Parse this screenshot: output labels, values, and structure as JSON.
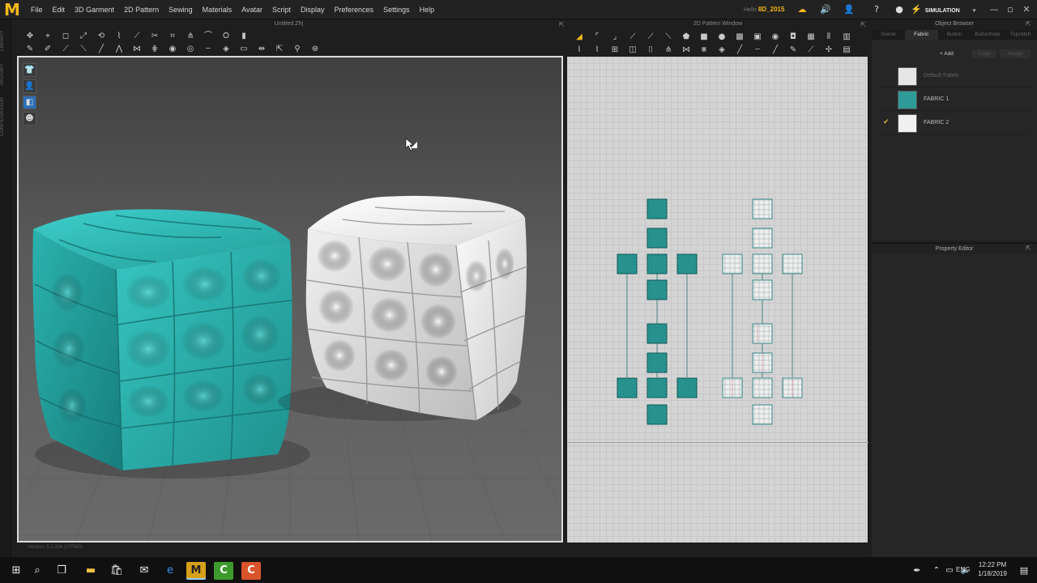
{
  "app": {
    "logo": "M",
    "window_title": "Untitled.Zfrj"
  },
  "menu": [
    "File",
    "Edit",
    "3D Garment",
    "2D Pattern",
    "Sewing",
    "Materials",
    "Avatar",
    "Script",
    "Display",
    "Preferences",
    "Settings",
    "Help"
  ],
  "user": {
    "hint": "Hello",
    "name": "IID_2015"
  },
  "simulation": {
    "label": "SIMULATION"
  },
  "left_tabs": [
    "LIBRARY",
    "HISTORY",
    "CONFIGURATOR"
  ],
  "pattern_window": {
    "title": "2D Pattern Window"
  },
  "object_browser": {
    "title": "Object Browser",
    "tabs": [
      "Scene",
      "Fabric",
      "Button",
      "Buttonhole",
      "Topstitch"
    ],
    "active_tab": "Fabric",
    "add_label": "+ Add",
    "copy_label": "Copy",
    "assign_label": "Assign",
    "fabrics": [
      {
        "name": "Default Fabric",
        "color": "#e6e6e6",
        "checked": false
      },
      {
        "name": "FABRIC 1",
        "color": "#2e9b98",
        "checked": false
      },
      {
        "name": "FABRIC 2",
        "color": "#f0f0f0",
        "checked": true
      }
    ]
  },
  "property_editor": {
    "title": "Property Editor"
  },
  "viewport_status": "Version: 5.2.334   (r27580)",
  "taskbar": {
    "lang": "ENG",
    "time": "12:22 PM",
    "date": "1/18/2019"
  },
  "colors": {
    "teal_fabric": "#2fb3b0",
    "white_fabric": "#f2f2f2",
    "accent": "#f4b81c"
  }
}
